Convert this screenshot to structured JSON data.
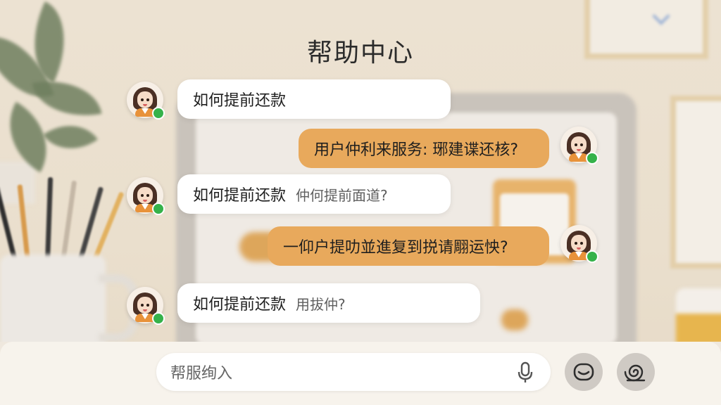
{
  "header": {
    "title": "帮助中心"
  },
  "messages": [
    {
      "side": "left",
      "text": "如何提前还款",
      "extra": ""
    },
    {
      "side": "right",
      "text": "用户仲利来服务: 琊建谍还核?"
    },
    {
      "side": "left",
      "text": "如何提前还款",
      "extra": "仲何提前面道?"
    },
    {
      "side": "right",
      "text": "一仰户提叻並進复到捝请翢运怏?"
    },
    {
      "side": "left",
      "text": "如何提前还款",
      "extra": "用拔仲?"
    }
  ],
  "input": {
    "placeholder": "帮服绚入"
  },
  "icons": {
    "mic": "microphone-icon",
    "emoji": "smiley-icon",
    "attach": "spiral-icon"
  },
  "colors": {
    "user_bubble": "#e8a95c",
    "agent_bubble": "#ffffff",
    "online": "#35b24a"
  }
}
